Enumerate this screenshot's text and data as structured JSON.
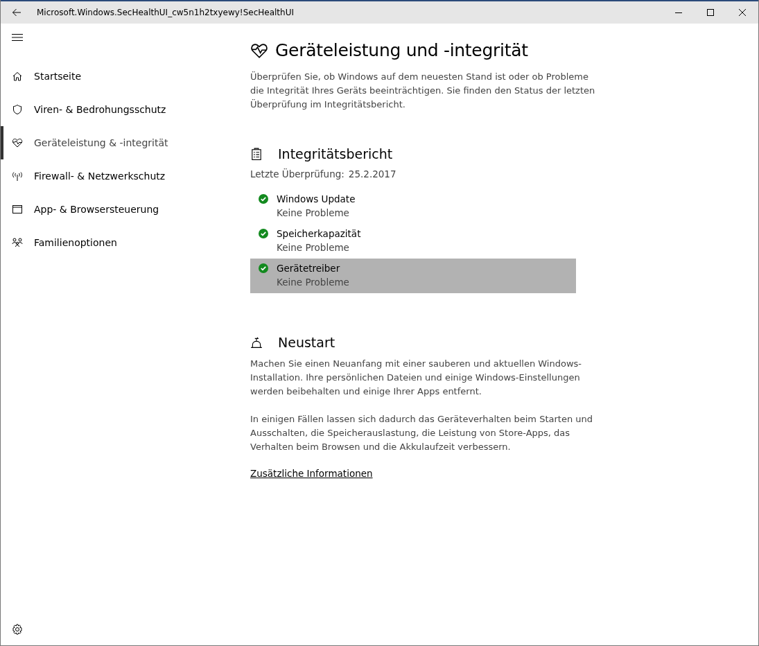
{
  "window": {
    "title": "Microsoft.Windows.SecHealthUI_cw5n1h2txyewy!SecHealthUI"
  },
  "sidebar": {
    "items": [
      {
        "label": "Startseite",
        "kind": "home",
        "selected": false
      },
      {
        "label": "Viren- & Bedrohungsschutz",
        "kind": "shield",
        "selected": false
      },
      {
        "label": "Geräteleistung & -integrität",
        "kind": "heart",
        "selected": true
      },
      {
        "label": "Firewall- & Netzwerkschutz",
        "kind": "antenna",
        "selected": false
      },
      {
        "label": "App- & Browsersteuerung",
        "kind": "window",
        "selected": false
      },
      {
        "label": "Familienoptionen",
        "kind": "family",
        "selected": false
      }
    ]
  },
  "page": {
    "title": "Geräteleistung und -integrität",
    "description": "Überprüfen Sie, ob Windows auf dem neuesten Stand ist oder ob Probleme die Integrität Ihres Geräts beeinträchtigen. Sie finden den Status der letzten Überprüfung im Integritätsbericht."
  },
  "report": {
    "title": "Integritätsbericht",
    "last_check_label": "Letzte Überprüfung:",
    "last_check_date": "25.2.2017",
    "items": [
      {
        "name": "Windows Update",
        "status": "Keine Probleme",
        "kind": "ok",
        "selected": false
      },
      {
        "name": "Speicherkapazität",
        "status": "Keine Probleme",
        "kind": "ok",
        "selected": false
      },
      {
        "name": "Gerätetreiber",
        "status": "Keine Probleme",
        "kind": "ok",
        "selected": true
      }
    ]
  },
  "fresh_start": {
    "title": "Neustart",
    "paragraphs": [
      "Machen Sie einen Neuanfang mit einer sauberen und aktuellen Windows-Installation. Ihre persönlichen Dateien und einige Windows-Einstellungen werden beibehalten und einige Ihrer Apps entfernt.",
      "In einigen Fällen lassen sich dadurch das Geräteverhalten beim Starten und Ausschalten, die Speicherauslastung, die Leistung von Store-Apps, das Verhalten beim Browsen und die Akkulaufzeit verbessern."
    ],
    "link": "Zusätzliche Informationen"
  }
}
